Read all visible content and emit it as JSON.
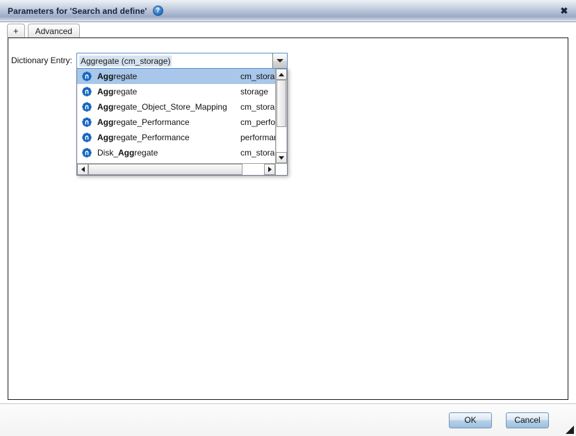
{
  "window": {
    "title": "Parameters for 'Search and define'",
    "help_icon": "help-icon",
    "help_glyph": "?",
    "close_icon": "close-icon",
    "close_glyph": "✖"
  },
  "tabs": [
    {
      "label": "+",
      "name": "add-tab"
    },
    {
      "label": "Advanced",
      "name": "advanced-tab"
    }
  ],
  "form": {
    "dictionary_entry": {
      "label": "Dictionary Entry:",
      "value": "Aggregate (cm_storage)",
      "placeholder": "Dictionary Entry",
      "dropdown_open": true
    }
  },
  "dropdown": {
    "highlight_color": "#a8c7ea",
    "icon_color": "#1565c0",
    "selected_index": 0,
    "match_prefix": "Agg",
    "items": [
      {
        "icon": "dictionary-entry-icon",
        "bold": "Agg",
        "rest": "regate",
        "prefix": "",
        "namespace": "cm_storage"
      },
      {
        "icon": "dictionary-entry-icon",
        "bold": "Agg",
        "rest": "regate",
        "prefix": "",
        "namespace": "storage"
      },
      {
        "icon": "dictionary-entry-icon",
        "bold": "Agg",
        "rest": "regate_Object_Store_Mapping",
        "prefix": "",
        "namespace": "cm_storage"
      },
      {
        "icon": "dictionary-entry-icon",
        "bold": "Agg",
        "rest": "regate_Performance",
        "prefix": "",
        "namespace": "cm_performance"
      },
      {
        "icon": "dictionary-entry-icon",
        "bold": "Agg",
        "rest": "regate_Performance",
        "prefix": "",
        "namespace": "performance"
      },
      {
        "icon": "dictionary-entry-icon",
        "bold": "Agg",
        "rest": "regate",
        "prefix": "Disk_",
        "namespace": "cm_storage"
      }
    ],
    "vscrollbar": {
      "up_icon": "scroll-up-icon",
      "down_icon": "scroll-down-icon"
    },
    "hscrollbar": {
      "left_icon": "scroll-left-icon",
      "right_icon": "scroll-right-icon"
    }
  },
  "footer": {
    "ok_label": "OK",
    "cancel_label": "Cancel",
    "resize_grip": "resize-grip-icon"
  }
}
